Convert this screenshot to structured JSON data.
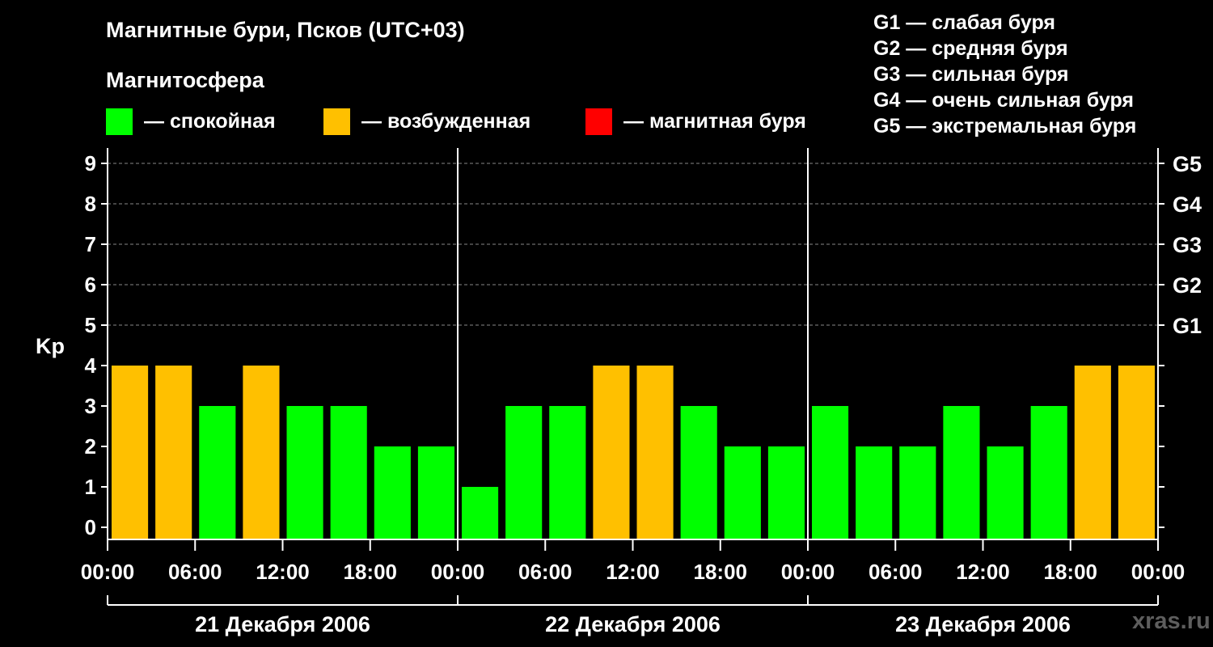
{
  "title": "Магнитные бури, Псков (UTC+03)",
  "subtitle": "Магнитосфера",
  "legend": [
    {
      "label": "— спокойная",
      "color": "#00ff00"
    },
    {
      "label": "— возбужденная",
      "color": "#ffc000"
    },
    {
      "label": "— магнитная буря",
      "color": "#ff0000"
    }
  ],
  "g_scale": [
    "G1 — слабая буря",
    "G2 — средняя буря",
    "G3 — сильная буря",
    "G4 — очень сильная буря",
    "G5 — экстремальная буря"
  ],
  "watermark": "xras.ru",
  "chart_data": {
    "type": "bar",
    "ylabel": "Kp",
    "ylim": [
      0,
      9
    ],
    "yticks": [
      "0",
      "1",
      "2",
      "3",
      "4",
      "5",
      "6",
      "7",
      "8",
      "9"
    ],
    "right_ticks": [
      "G1",
      "G2",
      "G3",
      "G4",
      "G5"
    ],
    "right_tick_values": [
      5,
      6,
      7,
      8,
      9
    ],
    "x_tick_labels": [
      "00:00",
      "06:00",
      "12:00",
      "18:00",
      "00:00",
      "06:00",
      "12:00",
      "18:00",
      "00:00",
      "06:00",
      "12:00",
      "18:00",
      "00:00"
    ],
    "days": [
      "21 Декабря 2006",
      "22 Декабря 2006",
      "23 Декабря 2006"
    ],
    "bars_per_day": 8,
    "grid": "dashed at 5–9",
    "values": [
      4,
      4,
      3,
      4,
      3,
      3,
      2,
      2,
      1,
      3,
      3,
      4,
      4,
      3,
      2,
      2,
      3,
      2,
      2,
      3,
      2,
      3,
      4,
      4
    ],
    "colors": {
      "quiet": "#00ff00",
      "active": "#ffc000",
      "storm": "#ff0000"
    }
  }
}
